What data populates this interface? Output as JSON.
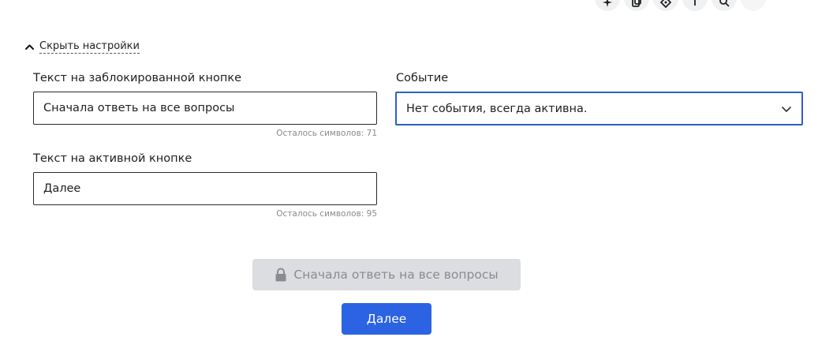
{
  "toolbar": {
    "icons": [
      "sparkle-icon",
      "copy-icon",
      "tag-icon",
      "upload-icon",
      "search-icon",
      "more-icon"
    ]
  },
  "settings_toggle": {
    "label": "Скрыть настройки"
  },
  "locked_text_field": {
    "label": "Текст на заблокированной кнопке",
    "value": "Сначала ответь на все вопросы",
    "counter": "Осталось символов: 71"
  },
  "active_text_field": {
    "label": "Текст на активной кнопке",
    "value": "Далее",
    "counter": "Осталось символов: 95"
  },
  "event_field": {
    "label": "Событие",
    "selected": "Нет события, всегда активна."
  },
  "preview": {
    "locked_button_label": "Сначала ответь на все вопросы",
    "active_button_label": "Далее"
  },
  "colors": {
    "accent": "#2b63e3",
    "select_border": "#2e5fc9",
    "locked_bg": "#dcdde1",
    "locked_text": "#8a8b91"
  }
}
